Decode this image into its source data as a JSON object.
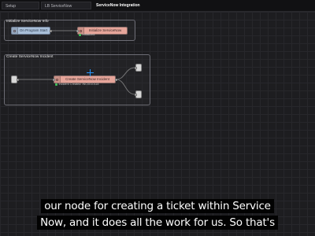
{
  "tabs": [
    {
      "label": "Setup",
      "active": false
    },
    {
      "label": "LB ServiceNow",
      "active": false
    },
    {
      "label": "ServiceNow Integration",
      "active": true
    }
  ],
  "groups": {
    "initialize": {
      "label": "Initialize ServiceNow Info",
      "inject_node": "On Program Start",
      "function_node": "Initialize ServiceNow",
      "status": "Initialized"
    },
    "create_incident": {
      "label": "Create ServiceNow Incident",
      "main_node": "Create ServiceNow Incident",
      "status": "Incident Created: INC0010118"
    }
  },
  "caption": {
    "line1": "our node for creating a ticket within Service",
    "line2": "Now, and it does all the work for us. So that's"
  },
  "colors": {
    "function_node": "#e6a59a",
    "inject_node": "#a9bfd8",
    "status_ok": "#3fbf5a",
    "cursor": "#2a98ff"
  }
}
